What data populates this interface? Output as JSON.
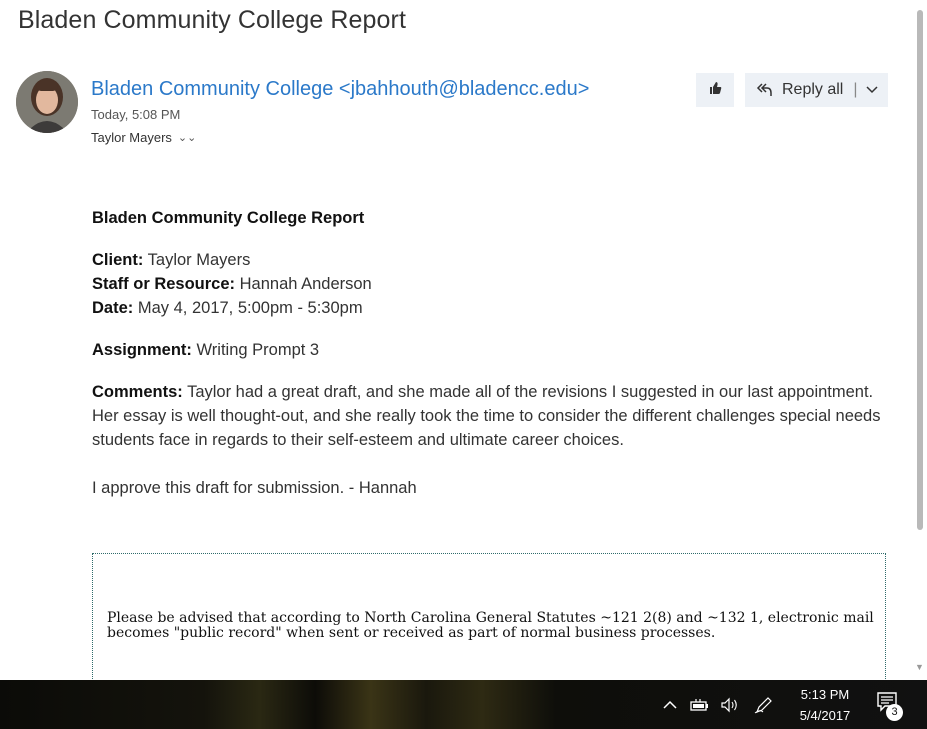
{
  "email": {
    "subject": "Bladen Community College Report",
    "sender": "Bladen Community College <jbahhouth@bladencc.edu>",
    "time": "Today, 5:08 PM",
    "recipient": "Taylor Mayers",
    "actions": {
      "reply_all_label": "Reply all"
    }
  },
  "report": {
    "title": "Bladen Community College Report",
    "client_label": "Client:",
    "client_value": "Taylor Mayers",
    "staff_label": "Staff or Resource:",
    "staff_value": "Hannah Anderson",
    "date_label": "Date:",
    "date_value": "May 4, 2017, 5:00pm - 5:30pm",
    "assignment_label": "Assignment:",
    "assignment_value": "Writing Prompt 3",
    "comments_label": "Comments:",
    "comments_value": "Taylor had a great draft, and she made all of the revisions I suggested in our last appointment. Her essay is well thought-out, and she really took the time to consider the different challenges special needs students face in regards to their self-esteem and ultimate career choices.",
    "approval": "I approve this draft for submission. - Hannah"
  },
  "notice": {
    "text": "Please be advised that according to North Carolina General Statutes ~121 2(8) and ~132 1, electronic mail becomes \"public record\" when sent or received as part of normal business processes."
  },
  "taskbar": {
    "time": "5:13 PM",
    "date": "5/4/2017",
    "notification_count": "3"
  },
  "icons": {
    "like": "thumbs-up-icon",
    "reply_all": "reply-all-icon",
    "dropdown": "chevron-down-icon",
    "expand_recipients": "double-chevron-down-icon",
    "tray_up": "chevron-up-icon",
    "battery": "battery-icon",
    "volume": "speaker-icon",
    "pen": "pen-icon",
    "notifications": "action-center-icon"
  }
}
